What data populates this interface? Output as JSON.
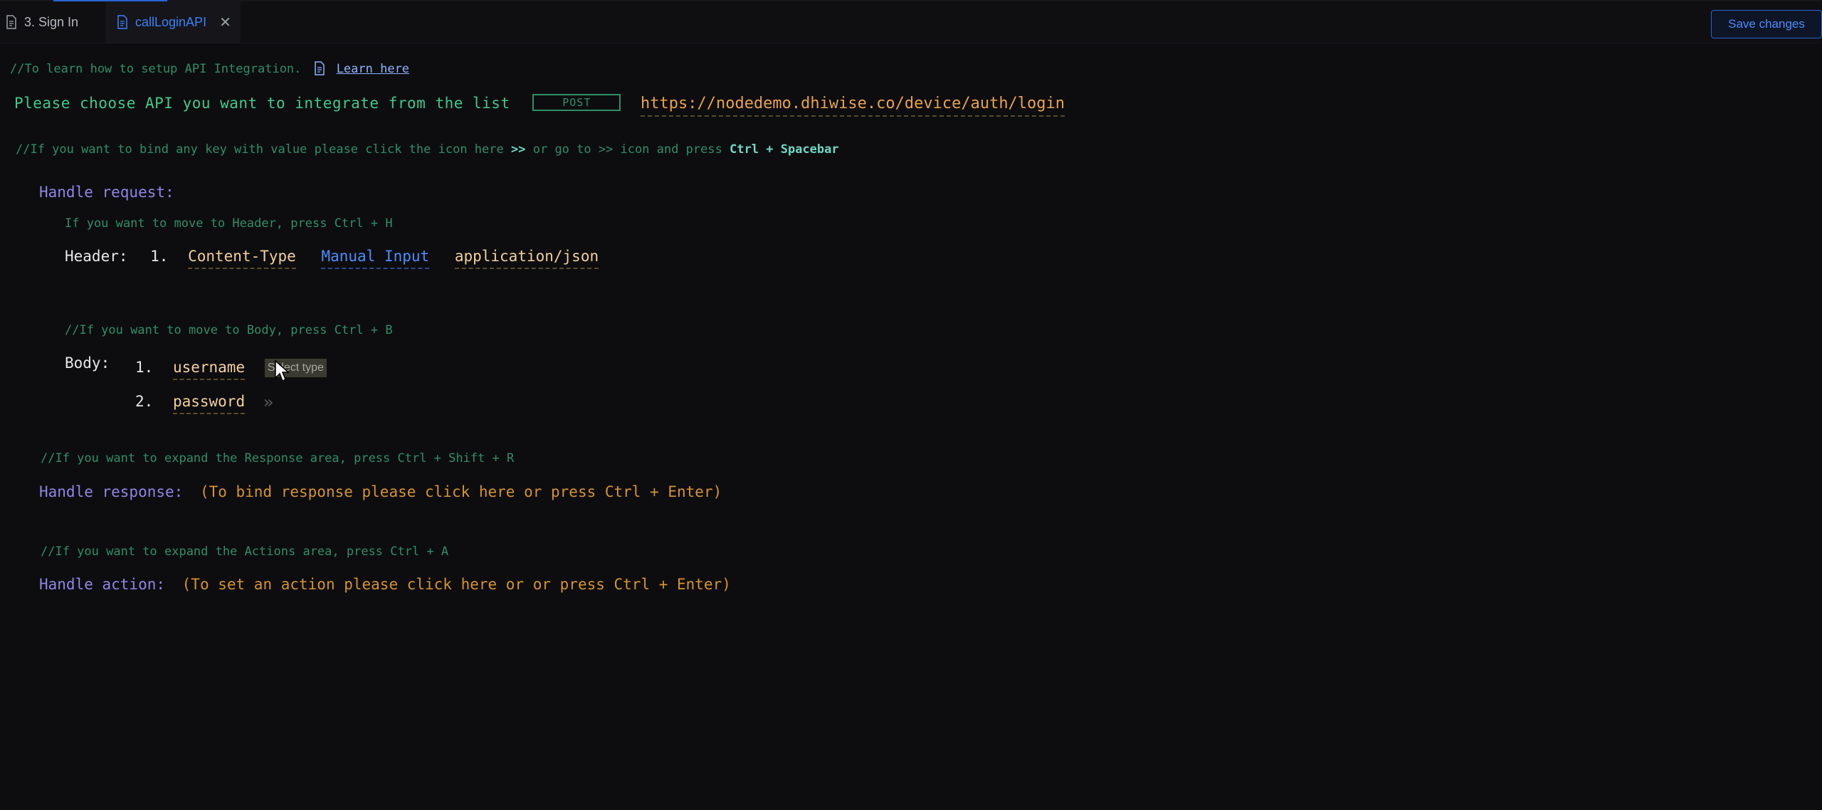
{
  "tabs": [
    {
      "label": "3. Sign In",
      "active": false
    },
    {
      "label": "callLoginAPI",
      "active": true
    }
  ],
  "toolbar": {
    "save_label": "Save changes"
  },
  "integration": {
    "setup_comment": "//To learn how to setup API Integration.",
    "learn_link": "Learn here",
    "choose_prompt": "Please choose API you want to integrate from the list",
    "method": "POST",
    "url": "https://nodedemo.dhiwise.co/device/auth/login",
    "bind_hint_prefix": "//If you want to bind any key with value please click the icon here",
    "bind_hint_icon": ">>",
    "bind_hint_middle": "or go to >> icon and press",
    "bind_hint_keys": "Ctrl + Spacebar"
  },
  "request": {
    "label": "Handle request:",
    "header_comment": "If you want to move to Header, press Ctrl + H",
    "header_label": "Header:",
    "header_rows": [
      {
        "index": "1.",
        "key": "Content-Type",
        "mode": "Manual Input",
        "value": "application/json"
      }
    ],
    "body_comment": "//If you want to move to Body, press Ctrl + B",
    "body_label": "Body:",
    "body_rows": [
      {
        "index": "1.",
        "key": "username",
        "type_placeholder": "Select type"
      },
      {
        "index": "2.",
        "key": "password",
        "icon": "double-chevron-right-icon"
      }
    ]
  },
  "response": {
    "comment": "//If you want to expand the Response area, press Ctrl + Shift + R",
    "label": "Handle response:",
    "hint": "(To bind response please click here or press Ctrl + Enter)"
  },
  "action": {
    "comment": "//If you want to expand the Actions area, press Ctrl + A",
    "label": "Handle action:",
    "hint": "(To set an action please click here or or press Ctrl + Enter)"
  },
  "colors": {
    "background": "#0d0d0f",
    "comment": "#2f8f66",
    "accent_blue": "#3b82f6",
    "section_purple": "#8f85e8",
    "url_orange": "#e8a34a"
  }
}
